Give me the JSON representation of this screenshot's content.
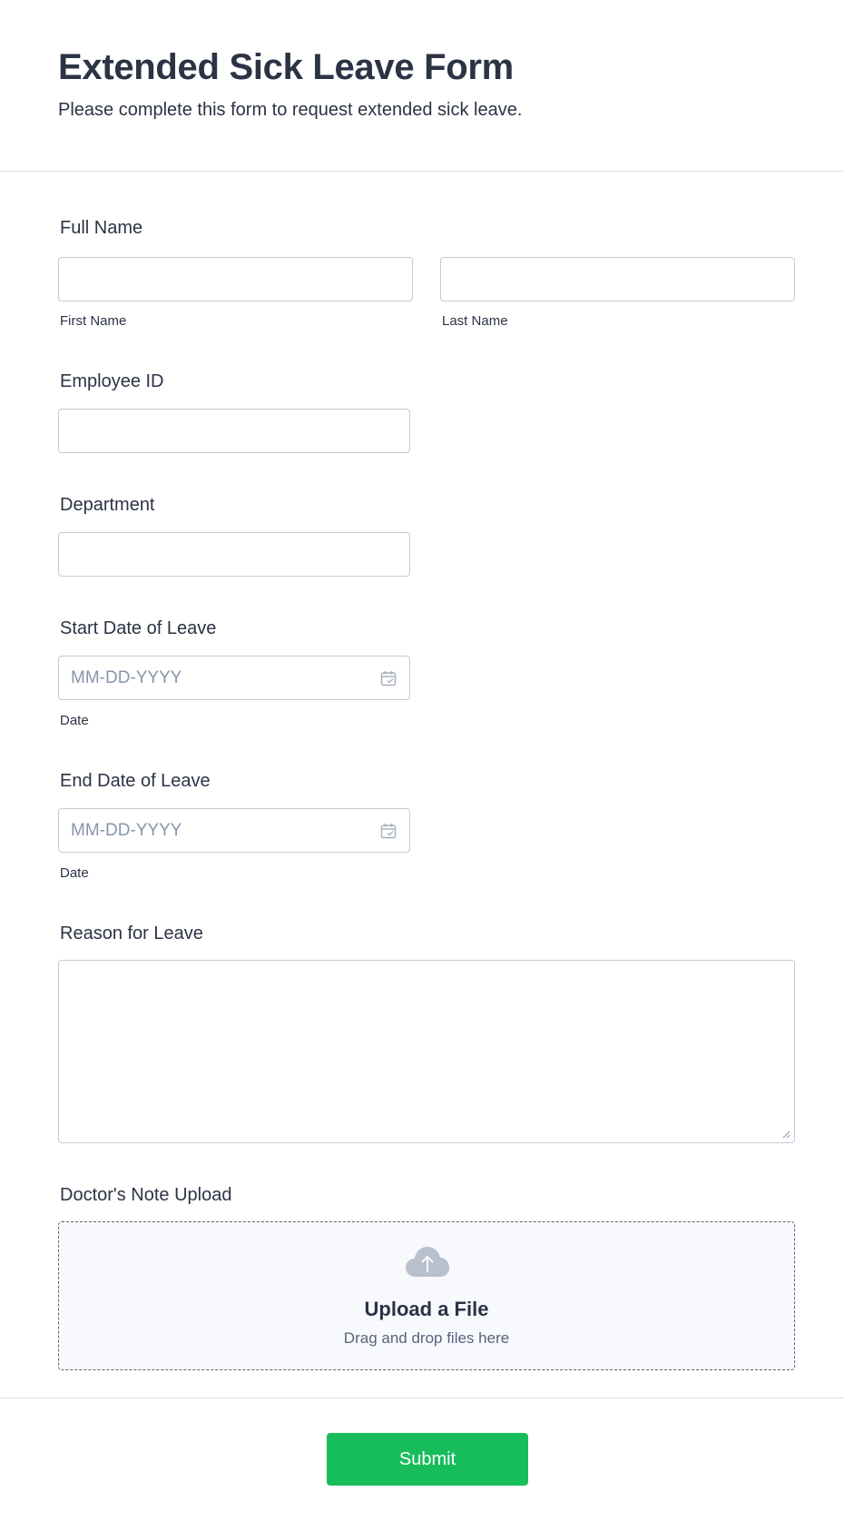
{
  "header": {
    "title": "Extended Sick Leave Form",
    "subtitle": "Please complete this form to request extended sick leave."
  },
  "fields": {
    "full_name": {
      "label": "Full Name",
      "first_sublabel": "First Name",
      "last_sublabel": "Last Name",
      "first_value": "",
      "last_value": ""
    },
    "employee_id": {
      "label": "Employee ID",
      "value": ""
    },
    "department": {
      "label": "Department",
      "value": ""
    },
    "start_date": {
      "label": "Start Date of Leave",
      "placeholder": "MM-DD-YYYY",
      "sublabel": "Date",
      "icon": "calendar-icon"
    },
    "end_date": {
      "label": "End Date of Leave",
      "placeholder": "MM-DD-YYYY",
      "sublabel": "Date",
      "icon": "calendar-icon"
    },
    "reason": {
      "label": "Reason for Leave",
      "value": ""
    },
    "doctors_note": {
      "label": "Doctor's Note Upload",
      "upload_title": "Upload a File",
      "upload_subtitle": "Drag and drop files here",
      "icon": "cloud-upload-icon"
    }
  },
  "submit": {
    "label": "Submit",
    "color": "#18bd5b"
  },
  "colors": {
    "text": "#2c3345",
    "border": "#c3cad8",
    "placeholder": "#8894ab"
  }
}
